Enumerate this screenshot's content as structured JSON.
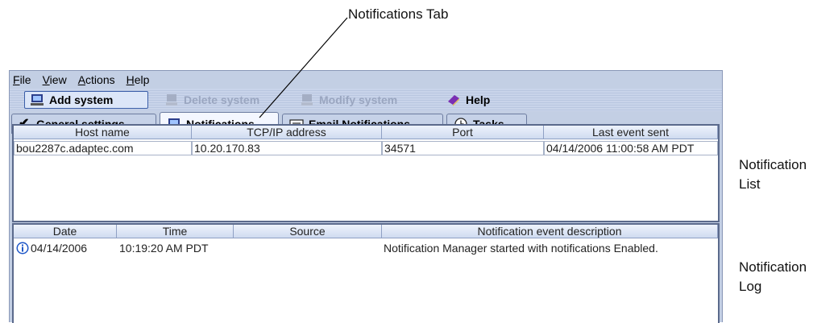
{
  "callouts": {
    "notifications_tab": "Notifications Tab",
    "notification_list": [
      "Notification",
      "List"
    ],
    "notification_log": [
      "Notification",
      "Log"
    ]
  },
  "menu": [
    {
      "label": "File",
      "mnemonic": "F",
      "rest": "ile"
    },
    {
      "label": "View",
      "mnemonic": "V",
      "rest": "iew"
    },
    {
      "label": "Actions",
      "mnemonic": "A",
      "rest": "ctions"
    },
    {
      "label": "Help",
      "mnemonic": "H",
      "rest": "elp"
    }
  ],
  "toolbar": {
    "add_system": "Add system",
    "delete_system": "Delete system",
    "modify_system": "Modify system",
    "help": "Help"
  },
  "tabs": {
    "general_settings": "General settings",
    "notifications": "Notifications",
    "email_notifications": "Email Notifications",
    "tasks": "Tasks",
    "selected": "Notifications"
  },
  "notification_list": {
    "columns": [
      "Host name",
      "TCP/IP address",
      "Port",
      "Last event sent"
    ],
    "rows": [
      [
        "bou2287c.adaptec.com",
        "10.20.170.83",
        "34571",
        "04/14/2006 11:00:58 AM PDT"
      ]
    ]
  },
  "notification_log": {
    "columns": [
      "Date",
      "Time",
      "Source",
      "Notification event description"
    ],
    "rows": [
      {
        "icon": "info-icon",
        "date": "04/14/2006",
        "time": "10:19:20 AM PDT",
        "source": "",
        "description": "Notification Manager started with notifications Enabled."
      }
    ]
  },
  "colors": {
    "chrome": "#c3cfe4",
    "accent_border": "#3b5ea8",
    "info_icon": "#1f57c8"
  }
}
